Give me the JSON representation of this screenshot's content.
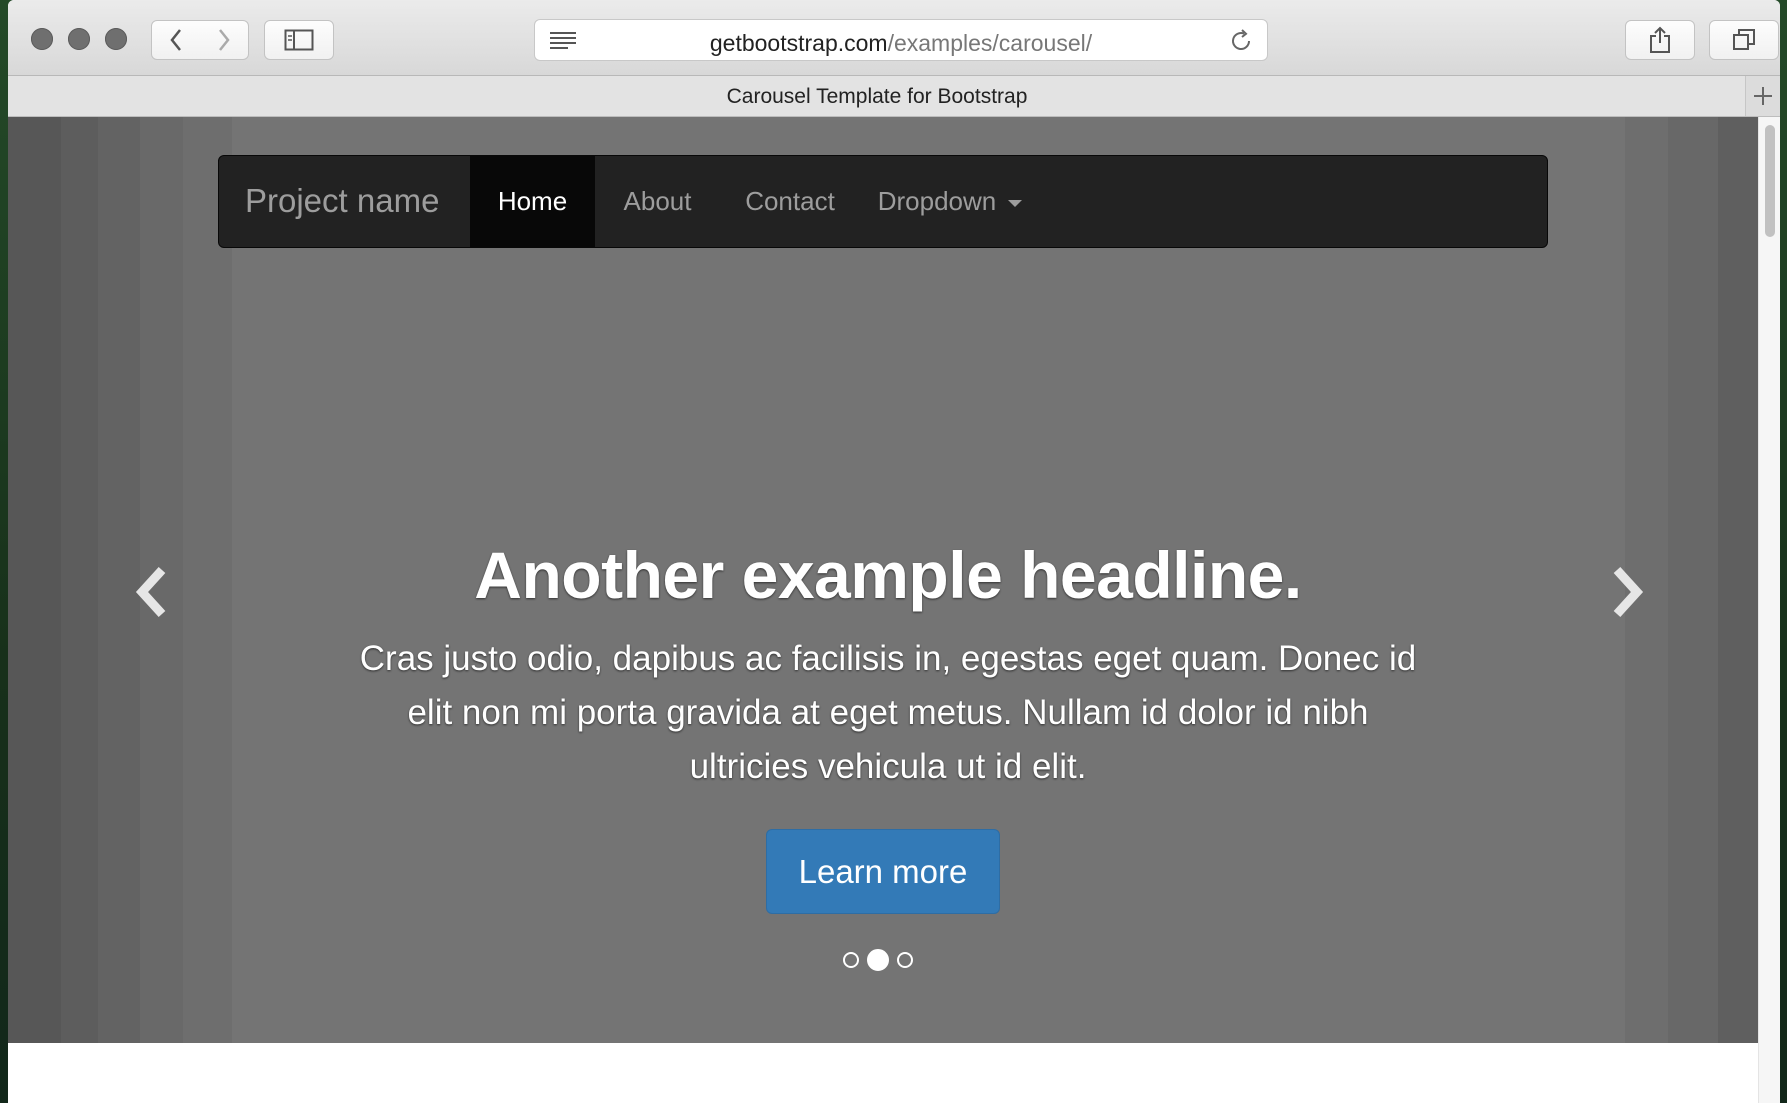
{
  "browser": {
    "url_host": "getbootstrap.com",
    "url_path": "/examples/carousel/",
    "tab_title": "Carousel Template for Bootstrap"
  },
  "navbar": {
    "brand": "Project name",
    "items": [
      {
        "label": "Home",
        "active": true
      },
      {
        "label": "About",
        "active": false
      },
      {
        "label": "Contact",
        "active": false
      },
      {
        "label": "Dropdown",
        "active": false,
        "has_caret": true
      }
    ]
  },
  "carousel": {
    "headline": "Another example headline.",
    "lead": "Cras justo odio, dapibus ac facilisis in, egestas eget quam. Donec id elit non mi porta gravida at eget metus. Nullam id dolor id nibh ultricies vehicula ut id elit.",
    "button_label": "Learn more",
    "slide_count": 3,
    "active_slide": 2,
    "prev_icon": "chevron-left-icon",
    "next_icon": "chevron-right-icon"
  },
  "colors": {
    "navbar_bg": "#222222",
    "button_primary": "#337ab7",
    "carousel_bg": "#777777"
  }
}
